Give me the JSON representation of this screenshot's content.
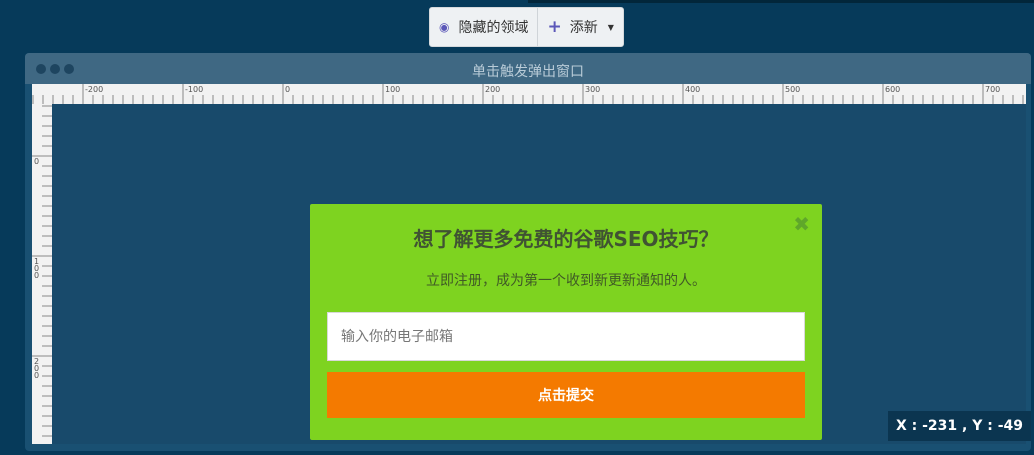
{
  "toolbar": {
    "hidden_area_label": "隐藏的领域",
    "add_label": "添新",
    "hidden_area_icon": "eye-icon",
    "add_icon": "plus-icon"
  },
  "window": {
    "title": "单击触发弹出窗口",
    "dot_color": "#1e4560",
    "titlebar_color": "#3f6883",
    "canvas_color": "#184a6b"
  },
  "ruler": {
    "h_labels": [
      "-200",
      "-100",
      "0",
      "100",
      "200",
      "300",
      "400",
      "500",
      "600",
      "700"
    ],
    "v_labels": [
      "0",
      "100",
      "200"
    ]
  },
  "popup": {
    "title": "想了解更多免费的谷歌SEO技巧？",
    "subtitle": "立即注册，成为第一个收到新更新通知的人。",
    "email_placeholder": "输入你的电子邮箱",
    "submit_label": "点击提交",
    "close_icon": "close-icon",
    "background_color": "#7ed320",
    "button_color": "#f47a00"
  },
  "coords": {
    "text": "X : -231  , Y : -49"
  }
}
